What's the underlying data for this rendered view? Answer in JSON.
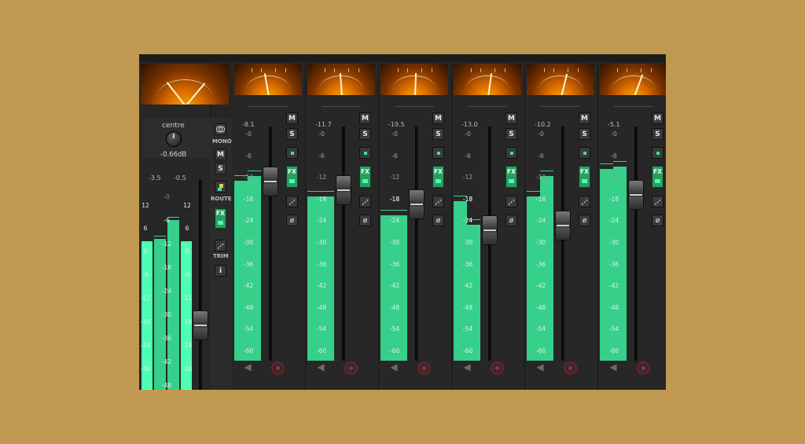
{
  "master": {
    "pan_label": "centre",
    "gain_label": "-0.66dB",
    "peaks": [
      "-3.5",
      "-0.5"
    ],
    "levels": [
      0.72,
      0.81
    ],
    "fader_level": 0.31,
    "scale_left": [
      "12",
      "6",
      "0",
      "-6",
      "-12",
      "-18",
      "-24",
      "-30",
      "-36"
    ],
    "scale_center": [
      "-0",
      "-6",
      "-12",
      "-18",
      "-24",
      "-30",
      "-36",
      "-42",
      "-48"
    ],
    "scale_right": [
      "12",
      "6",
      "0",
      "-6",
      "-12",
      "-18",
      "-24",
      "-30",
      "-36"
    ]
  },
  "side_buttons": {
    "mono_label": "MONO",
    "mute_label": "M",
    "solo_label": "S",
    "route_label": "ROUTE",
    "fx_label": "FX",
    "trim_label": "TRIM",
    "info_label": "i"
  },
  "channels": [
    {
      "peak": "-8.1",
      "levels": [
        0.77,
        0.79
      ],
      "fader_level": 0.77
    },
    {
      "peak": "-11.7",
      "levels": [
        0.7,
        0.7
      ],
      "fader_level": 0.73
    },
    {
      "peak": "-19.5",
      "levels": [
        0.62,
        0.62
      ],
      "fader_level": 0.67
    },
    {
      "peak": "-13.0",
      "levels": [
        0.68,
        0.58
      ],
      "fader_level": 0.56
    },
    {
      "peak": "-10.2",
      "levels": [
        0.7,
        0.79
      ],
      "fader_level": 0.58
    },
    {
      "peak": "-5.1",
      "levels": [
        0.82,
        0.83
      ],
      "fader_level": 0.71
    }
  ],
  "channel_scale": [
    "-0",
    "-6",
    "-12",
    "-18",
    "-24",
    "-30",
    "-36",
    "-42",
    "-48",
    "-54",
    "-60"
  ],
  "channel_buttons": {
    "mute": "M",
    "solo": "S",
    "fx": "FX",
    "phase": "ø"
  },
  "icons": {
    "vu_meter": "vu-meter-icon",
    "mute": "speaker-icon",
    "record": "record-icon",
    "automation": "automation-icon",
    "phase": "phase-invert-icon",
    "link": "stereo-link-icon"
  },
  "colors": {
    "background": "#bf9951",
    "meter_green": "#36d08a",
    "button_green": "#2b9c64",
    "record_red": "#a22a3d"
  }
}
